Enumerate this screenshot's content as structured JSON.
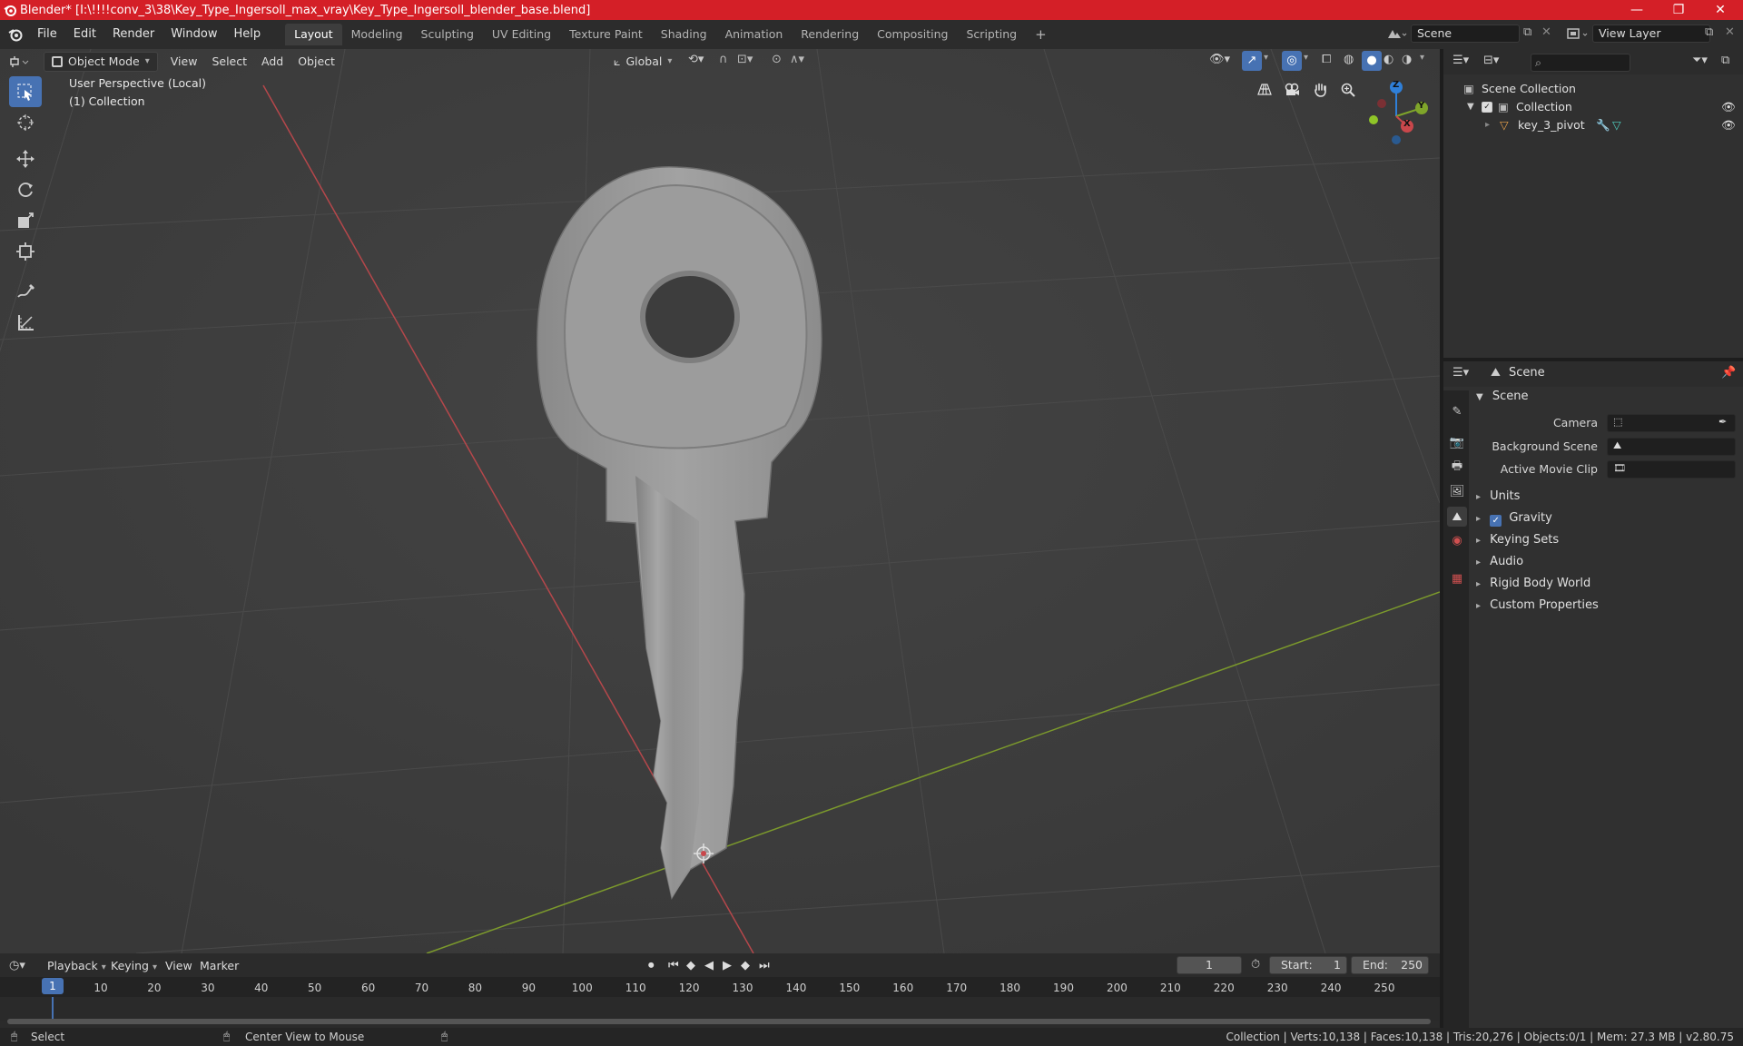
{
  "window": {
    "title": "Blender* [I:\\!!!!conv_3\\38\\Key_Type_Ingersoll_max_vray\\Key_Type_Ingersoll_blender_base.blend]",
    "minimize": "—",
    "maximize": "❐",
    "close": "✕"
  },
  "menubar": {
    "items": [
      "File",
      "Edit",
      "Render",
      "Window",
      "Help"
    ]
  },
  "workspaces": {
    "tabs": [
      "Layout",
      "Modeling",
      "Sculpting",
      "UV Editing",
      "Texture Paint",
      "Shading",
      "Animation",
      "Rendering",
      "Compositing",
      "Scripting"
    ],
    "active": "Layout",
    "add": "+"
  },
  "scene_selector": {
    "value": "Scene"
  },
  "view_layer_selector": {
    "value": "View Layer"
  },
  "viewport_header": {
    "mode": "Object Mode",
    "menus": [
      "View",
      "Select",
      "Add",
      "Object"
    ],
    "transform_orientation": "Global"
  },
  "viewport": {
    "perspective": "User Perspective (Local)",
    "collection": "(1) Collection",
    "gizmo": {
      "z": "Z",
      "y": "Y",
      "x": "X"
    }
  },
  "outliner": {
    "search_placeholder": "",
    "root": "Scene Collection",
    "collection": "Collection",
    "object": "key_3_pivot"
  },
  "properties": {
    "context": "Scene",
    "section": "Scene",
    "camera_label": "Camera",
    "background_scene_label": "Background Scene",
    "active_movie_clip_label": "Active Movie Clip",
    "panels": [
      "Units",
      "Gravity",
      "Keying Sets",
      "Audio",
      "Rigid Body World",
      "Custom Properties"
    ],
    "gravity_checked": true
  },
  "timeline": {
    "menus": [
      "Playback",
      "Keying",
      "View",
      "Marker"
    ],
    "current_frame": "1",
    "start_label": "Start:",
    "start": "1",
    "end_label": "End:",
    "end": "250",
    "ticks": [
      "1",
      "10",
      "20",
      "30",
      "40",
      "50",
      "60",
      "70",
      "80",
      "90",
      "100",
      "110",
      "120",
      "130",
      "140",
      "150",
      "160",
      "170",
      "180",
      "190",
      "200",
      "210",
      "220",
      "230",
      "240",
      "250"
    ]
  },
  "statusbar": {
    "select": "Select",
    "center_view": "Center View to Mouse",
    "stats": "Collection | Verts:10,138 | Faces:10,138 | Tris:20,276 | Objects:0/1 | Mem: 27.3 MB | v2.80.75"
  },
  "colors": {
    "titlebar": "#d41f27",
    "accent": "#4772b3",
    "x_axis": "#c9474b",
    "y_axis": "#7fa52a",
    "z_axis": "#2f7fd8"
  }
}
